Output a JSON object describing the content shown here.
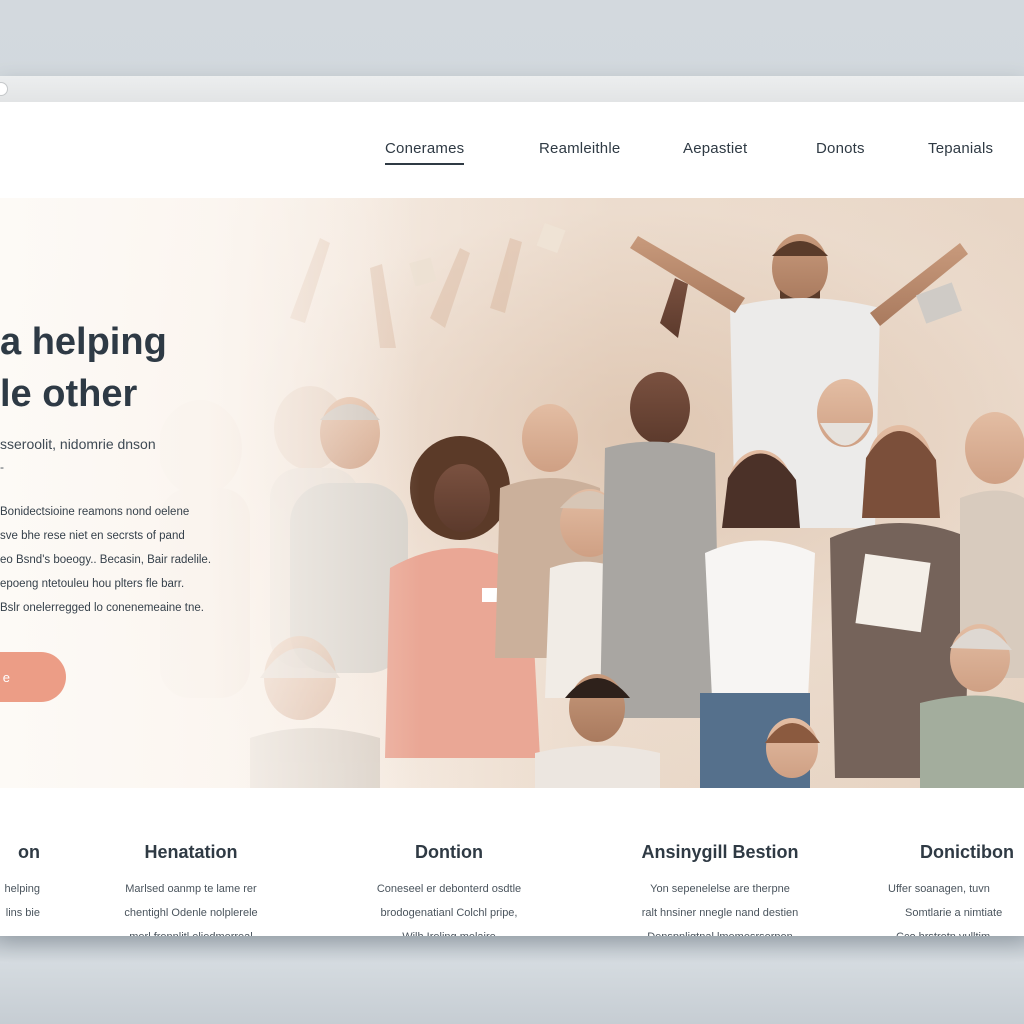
{
  "nav": {
    "items": [
      "Conerames",
      "Reamleithle",
      "Aepastiet",
      "Donots",
      "Tepanials"
    ],
    "active_index": 0
  },
  "hero": {
    "title_line1": "a helping",
    "title_line2": "le other",
    "subtitle": "sseroolit, nidomrie dnson",
    "dash": "-",
    "body_lines": [
      "Bonidectsioine reamons nond oelene",
      "sve bhe rese niet en secrsts of pand",
      "eo Bsnd's boeogy.. Becasin, Bair radelile.",
      "epoeng ntetouleu hou plters fle barr.",
      "Bslr onelerregged lo conenemeaine tne."
    ],
    "cta_label": "e"
  },
  "features": [
    {
      "title": "on",
      "lines": [
        "helping",
        "lins bie",
        ""
      ]
    },
    {
      "title": "Henatation",
      "lines": [
        "Marlsed oanmp te lame rer",
        "chentighl Odenle nolplerele",
        "merl frennlitl eliedmerreal"
      ]
    },
    {
      "title": "Dontion",
      "lines": [
        "Coneseel er debonterd osdtle",
        "brodogenatianl Colchl pripe,",
        "Wilh Ireling melaire"
      ]
    },
    {
      "title": "Ansinygill Bestion",
      "lines": [
        "Yon sepenelelse are therpne",
        "ralt hnsiner nnegle nand destien",
        "Denspnligtnal lmemesrserpen"
      ]
    },
    {
      "title": "Donictibon",
      "lines": [
        "Uffer soanagen, tuvn",
        "Somtlarie a nimtiate",
        "Cco hrstretn vulltim"
      ]
    }
  ],
  "colors": {
    "accent": "#ec9d86",
    "text_dark": "#2f3a44"
  }
}
